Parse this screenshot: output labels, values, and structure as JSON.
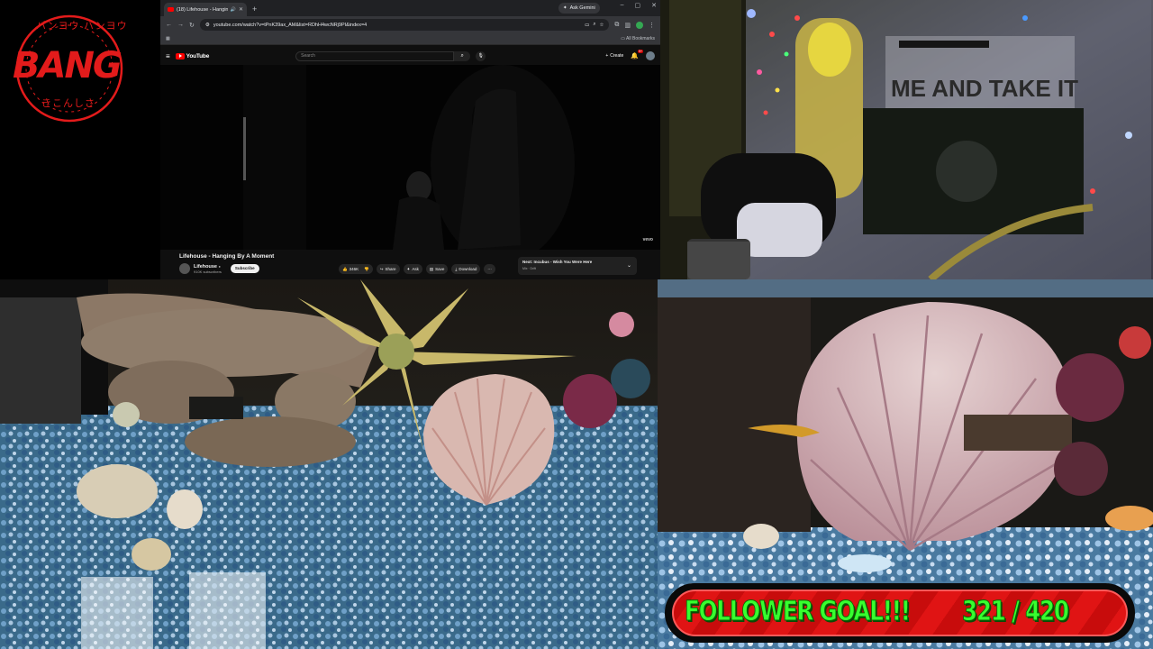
{
  "logo": {
    "text": "BANG",
    "ring_text_top": "バンヨウ バンヨウ",
    "ring_text_bottom": "きこんしさ",
    "color": "#e31b1b"
  },
  "browser": {
    "tab_title": "(18) Lifehouse - Hanging B",
    "ask_gemini": "Ask Gemini",
    "url": "youtube.com/watch?v=tPnK39ax_AM&list=RDhH4wcNRj9PI&index=4",
    "bookmarks_label": "All Bookmarks"
  },
  "youtube": {
    "logo_text": "YouTube",
    "search_placeholder": "Search",
    "create_label": "Create",
    "notification_count": "9+",
    "watermark": "vevo",
    "video_title": "Lifehouse - Hanging By A Moment",
    "channel_name": "Lifehouse",
    "subscribers": "910K subscribers",
    "subscribe_label": "Subscribe",
    "likes": "346K",
    "share_label": "Share",
    "ask_label": "Ask",
    "save_label": "Save",
    "download_label": "Download",
    "next_label": "Next: Incubus - Wish You Were Here",
    "next_sub": "Mix · Drift"
  },
  "camera_top_right": {
    "banner_text": "ME AND TAKE IT"
  },
  "follower_goal": {
    "label": "FOLLOWER GOAL!!!",
    "current": 321,
    "target": 420,
    "count_text": "321 / 420",
    "text_color": "#37ff2f",
    "bar_color": "#e01414"
  }
}
